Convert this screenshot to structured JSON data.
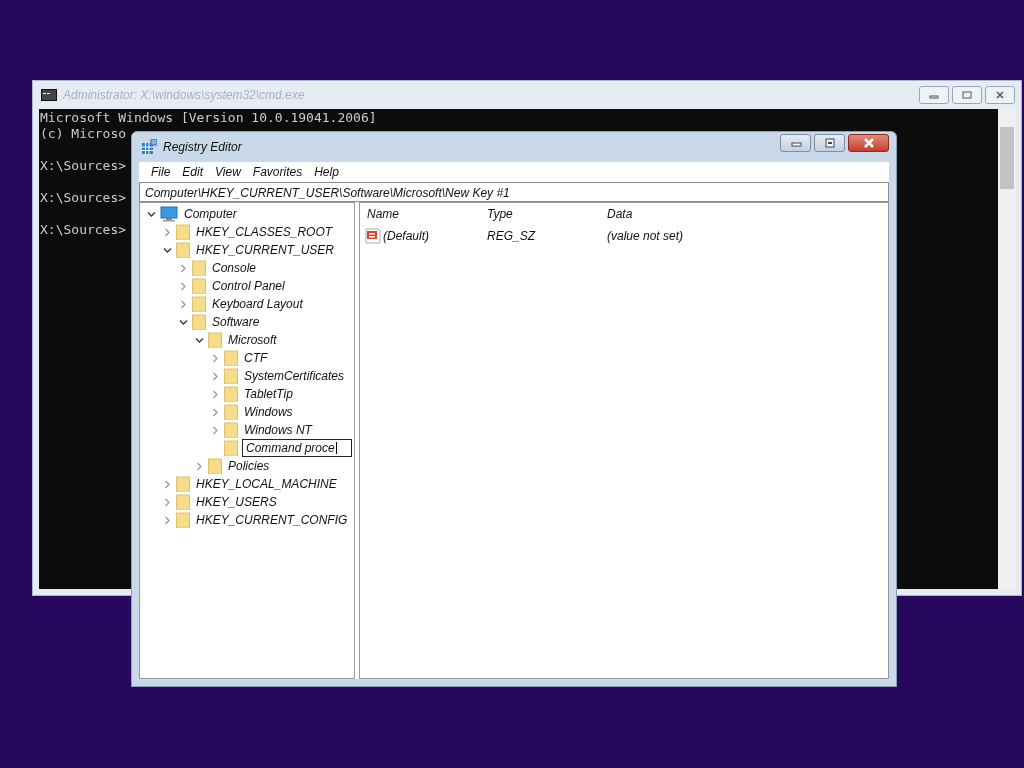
{
  "console_window": {
    "title": "Administrator: X:\\windows\\system32\\cmd.exe",
    "blocks": [
      [
        "Microsoft Windows [Version 10.0.19041.2006]",
        "(c) Microso"
      ],
      [
        "X:\\Sources>"
      ],
      [
        "X:\\Sources>"
      ],
      [
        "X:\\Sources>"
      ]
    ]
  },
  "registry_editor": {
    "title": "Registry Editor",
    "menu": [
      "File",
      "Edit",
      "View",
      "Favorites",
      "Help"
    ],
    "address": "Computer\\HKEY_CURRENT_USER\\Software\\Microsoft\\New Key #1",
    "tree": [
      {
        "label": "Computer",
        "kind": "computer",
        "expanded": true,
        "children": [
          {
            "label": "HKEY_CLASSES_ROOT",
            "kind": "key",
            "expanded": false
          },
          {
            "label": "HKEY_CURRENT_USER",
            "kind": "key",
            "expanded": true,
            "children": [
              {
                "label": "Console",
                "kind": "key",
                "expanded": false
              },
              {
                "label": "Control Panel",
                "kind": "key",
                "expanded": false
              },
              {
                "label": "Keyboard Layout",
                "kind": "key",
                "expanded": false
              },
              {
                "label": "Software",
                "kind": "key",
                "expanded": true,
                "children": [
                  {
                    "label": "Microsoft",
                    "kind": "key",
                    "expanded": true,
                    "children": [
                      {
                        "label": "CTF",
                        "kind": "key",
                        "expanded": false
                      },
                      {
                        "label": "SystemCertificates",
                        "kind": "key",
                        "expanded": false
                      },
                      {
                        "label": "TabletTip",
                        "kind": "key",
                        "expanded": false
                      },
                      {
                        "label": "Windows",
                        "kind": "key",
                        "expanded": false
                      },
                      {
                        "label": "Windows NT",
                        "kind": "key",
                        "expanded": false
                      },
                      {
                        "label": "Command proce",
                        "kind": "editing"
                      }
                    ]
                  },
                  {
                    "label": "Policies",
                    "kind": "key",
                    "expanded": false
                  }
                ]
              }
            ]
          },
          {
            "label": "HKEY_LOCAL_MACHINE",
            "kind": "key",
            "expanded": false
          },
          {
            "label": "HKEY_USERS",
            "kind": "key",
            "expanded": false
          },
          {
            "label": "HKEY_CURRENT_CONFIG",
            "kind": "key",
            "expanded": false
          }
        ]
      }
    ],
    "columns": [
      "Name",
      "Type",
      "Data"
    ],
    "values": [
      {
        "name": "(Default)",
        "type": "REG_SZ",
        "data": "(value not set)"
      }
    ]
  }
}
